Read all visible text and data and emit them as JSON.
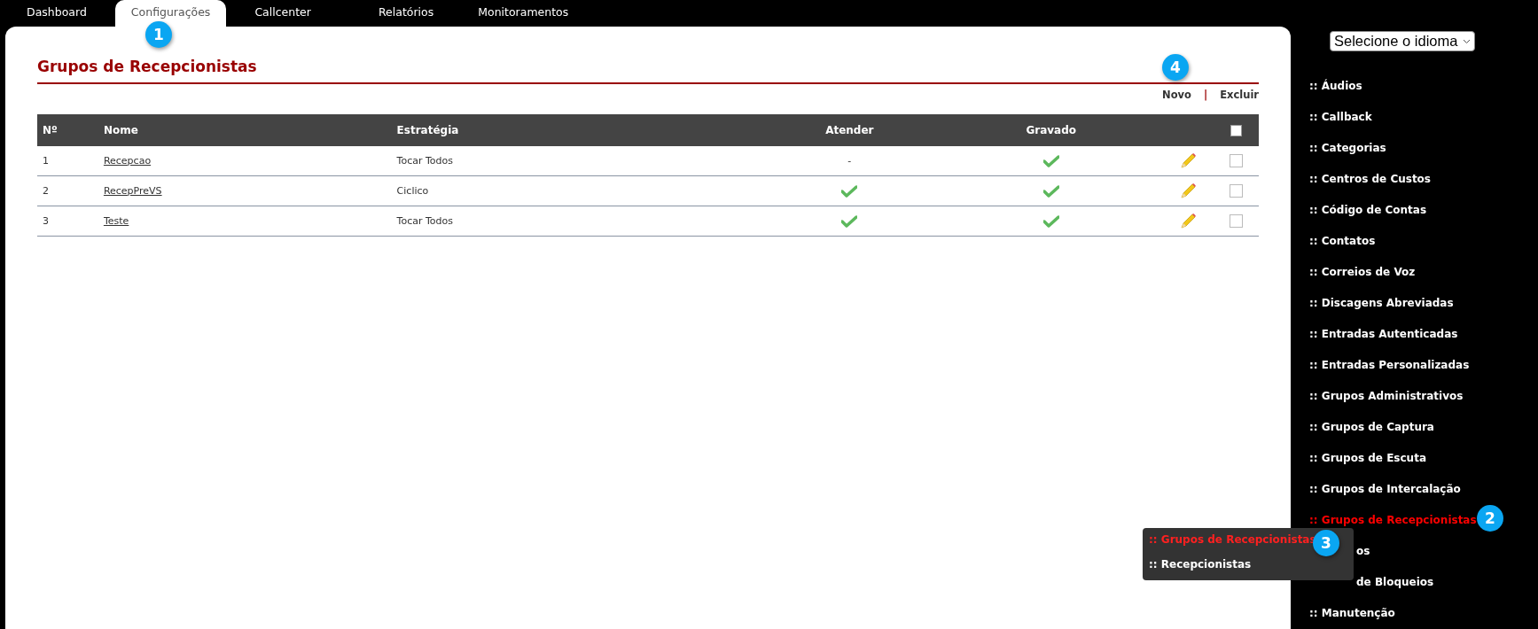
{
  "tabs": [
    {
      "label": "Dashboard",
      "selected": false
    },
    {
      "label": "Configurações",
      "selected": true
    },
    {
      "label": "Callcenter",
      "selected": false
    },
    {
      "label": "Relatórios",
      "selected": false
    },
    {
      "label": "Monitoramentos",
      "selected": false
    }
  ],
  "page": {
    "title": "Grupos de Recepcionistas",
    "actions": [
      "Novo",
      "Excluir"
    ],
    "separator": "|"
  },
  "table": {
    "columns": [
      "Nº",
      "Nome",
      "Estratégia",
      "Atender",
      "Gravado"
    ],
    "select_all_checked": false,
    "rows": [
      {
        "number": "1",
        "name": "Recepcao",
        "strategy": "Tocar Todos",
        "atender": {
          "kind": "text",
          "text": "-"
        },
        "gravado": {
          "kind": "check"
        },
        "checked": false
      },
      {
        "number": "2",
        "name": "RecepPreVS",
        "strategy": "Ciclico",
        "atender": {
          "kind": "check"
        },
        "gravado": {
          "kind": "check"
        },
        "checked": false
      },
      {
        "number": "3",
        "name": "Teste",
        "strategy": "Tocar Todos",
        "atender": {
          "kind": "check"
        },
        "gravado": {
          "kind": "check"
        },
        "checked": false
      }
    ]
  },
  "language_select": {
    "value": "Selecione o idioma"
  },
  "sidebar": {
    "items": [
      {
        "label": ":: Áudios",
        "selected": false,
        "kind": "full"
      },
      {
        "label": ":: Callback",
        "selected": false,
        "kind": "full"
      },
      {
        "label": ":: Categorias",
        "selected": false,
        "kind": "full"
      },
      {
        "label": ":: Centros de Custos",
        "selected": false,
        "kind": "full"
      },
      {
        "label": ":: Código de Contas",
        "selected": false,
        "kind": "full"
      },
      {
        "label": ":: Contatos",
        "selected": false,
        "kind": "full"
      },
      {
        "label": ":: Correios de Voz",
        "selected": false,
        "kind": "full"
      },
      {
        "label": ":: Discagens Abreviadas",
        "selected": false,
        "kind": "full"
      },
      {
        "label": ":: Entradas Autenticadas",
        "selected": false,
        "kind": "full"
      },
      {
        "label": ":: Entradas Personalizadas",
        "selected": false,
        "kind": "full"
      },
      {
        "label": ":: Grupos Administrativos",
        "selected": false,
        "kind": "full"
      },
      {
        "label": ":: Grupos de Captura",
        "selected": false,
        "kind": "full"
      },
      {
        "label": ":: Grupos de Escuta",
        "selected": false,
        "kind": "full"
      },
      {
        "label": ":: Grupos de Intercalação",
        "selected": false,
        "kind": "full"
      },
      {
        "label": ":: Grupos de Recepcionistas",
        "selected": true,
        "kind": "full"
      },
      {
        "label": "os",
        "selected": false,
        "kind": "partly_hidden"
      },
      {
        "label": "de Bloqueios",
        "selected": false,
        "kind": "partly_hidden"
      },
      {
        "label": ":: Manutenção",
        "selected": false,
        "kind": "full"
      }
    ]
  },
  "submenu": {
    "items": [
      {
        "label": ":: Grupos de Recepcionistas",
        "selected": true
      },
      {
        "label": ":: Recepcionistas",
        "selected": false
      }
    ]
  },
  "callouts": [
    "1",
    "2",
    "3",
    "4"
  ]
}
